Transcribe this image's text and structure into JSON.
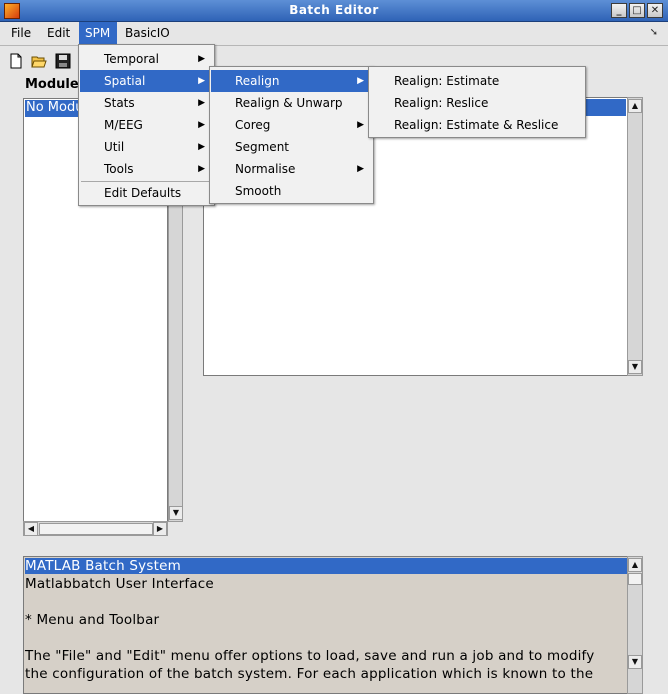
{
  "window": {
    "title": "Batch Editor"
  },
  "menubar": {
    "items": [
      "File",
      "Edit",
      "SPM",
      "BasicIO"
    ]
  },
  "module_panel": {
    "label": "Module",
    "selected_item": "No Module"
  },
  "spm_menu": {
    "items": [
      "Temporal",
      "Spatial",
      "Stats",
      "M/EEG",
      "Util",
      "Tools"
    ],
    "footer": "Edit Defaults"
  },
  "spatial_menu": {
    "items": [
      "Realign",
      "Realign & Unwarp",
      "Coreg",
      "Segment",
      "Normalise",
      "Smooth"
    ]
  },
  "realign_menu": {
    "items": [
      "Realign: Estimate",
      "Realign: Reslice",
      "Realign: Estimate & Reslice"
    ]
  },
  "help": {
    "lines": [
      "MATLAB Batch System",
      "Matlabbatch User Interface",
      "",
      "* Menu and Toolbar",
      "",
      "The \"File\" and \"Edit\" menu offer options to load, save and run a job and to modify",
      "the configuration of the batch system. For each application which is known to the"
    ]
  }
}
